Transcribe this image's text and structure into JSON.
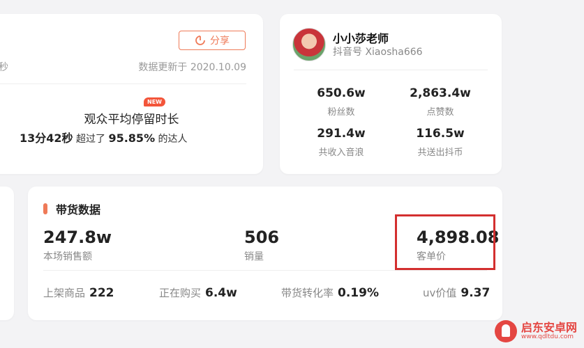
{
  "stats_card": {
    "share_label": "分享",
    "cut_text": "秒",
    "updated_text": "数据更新于 2020.10.09",
    "new_badge": "NEW",
    "stay_title": "观众平均停留时长",
    "stay_value": "13分42秒",
    "stay_mid": "超过了",
    "stay_percent": "95.85%",
    "stay_suffix": "的达人"
  },
  "profile": {
    "name": "小小莎老师",
    "id_text": "抖音号 Xiaosha666",
    "stats": [
      {
        "value": "650.6w",
        "label": "粉丝数"
      },
      {
        "value": "2,863.4w",
        "label": "点赞数"
      },
      {
        "value": "291.4w",
        "label": "共收入音浪"
      },
      {
        "value": "116.5w",
        "label": "共送出抖币"
      }
    ]
  },
  "sales": {
    "title": "带货数据",
    "metrics": [
      {
        "value": "247.8w",
        "label": "本场销售额"
      },
      {
        "value": "506",
        "label": "销量"
      },
      {
        "value": "4,898.08",
        "label": "客单价"
      }
    ],
    "footer": [
      {
        "label": "上架商品",
        "value": "222"
      },
      {
        "label": "正在购买",
        "value": "6.4w"
      },
      {
        "label": "带货转化率",
        "value": "0.19%"
      },
      {
        "label": "uv价值",
        "value": "9.37"
      }
    ]
  },
  "watermark": {
    "title": "启东安卓网",
    "url": "www.qdltdu.com"
  },
  "colors": {
    "accent": "#ef7a58",
    "highlight": "#d32f2f",
    "badge": "#f3553a"
  }
}
